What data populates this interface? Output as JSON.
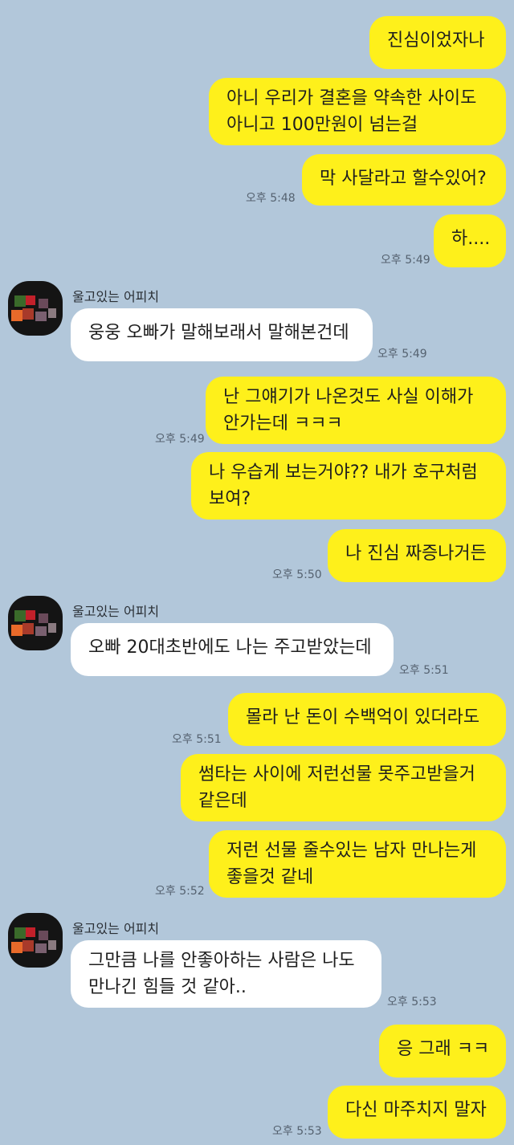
{
  "contact": {
    "name": "울고있는 어피치"
  },
  "messages": {
    "m1": {
      "text": "진심이었자나"
    },
    "m2a": {
      "text": "아니 우리가 결혼을 약속한 사이도"
    },
    "m2b": {
      "text": "아니고 100만원이 넘는걸"
    },
    "m3": {
      "text": "막 사달라고 할수있어?",
      "time": "오후 5:48"
    },
    "m4": {
      "text": "하....",
      "time": "오후 5:49"
    },
    "o1": {
      "text": "웅웅 오빠가 말해보래서 말해본건데",
      "time": "오후 5:49"
    },
    "m5a": {
      "text": "난 그얘기가 나온것도 사실 이해가"
    },
    "m5b": {
      "text": "안가는데 ㅋㅋㅋ",
      "time": "오후 5:49"
    },
    "m6a": {
      "text": "나 우습게 보는거야?? 내가 호구처럼"
    },
    "m6b": {
      "text": "보여?"
    },
    "m7": {
      "text": "나 진심 짜증나거든",
      "time": "오후 5:50"
    },
    "o2": {
      "text": "오빠 20대초반에도 나는 주고받았는데",
      "time": "오후 5:51"
    },
    "m8": {
      "text": "몰라 난 돈이 수백억이 있더라도",
      "time": "오후 5:51"
    },
    "m9a": {
      "text": "썸타는 사이에 저런선물 못주고받을거"
    },
    "m9b": {
      "text": "같은데"
    },
    "m10a": {
      "text": "저런 선물 줄수있는 남자 만나는게"
    },
    "m10b": {
      "text": "좋을것 같네",
      "time": "오후 5:52"
    },
    "o3a": {
      "text": "그만큼 나를 안좋아하는 사람은 나도"
    },
    "o3b": {
      "text": "만나긴 힘들 것 같아..",
      "time": "오후 5:53"
    },
    "m11": {
      "text": "응 그래 ㅋㅋ"
    },
    "m12": {
      "text": "다신 마주치지 말자",
      "time": "오후 5:53"
    }
  },
  "colors": {
    "background": "#b2c7da",
    "my_bubble": "#fef01b",
    "their_bubble": "#ffffff"
  },
  "icons": {
    "avatar": "pixelated-avatar-icon"
  }
}
